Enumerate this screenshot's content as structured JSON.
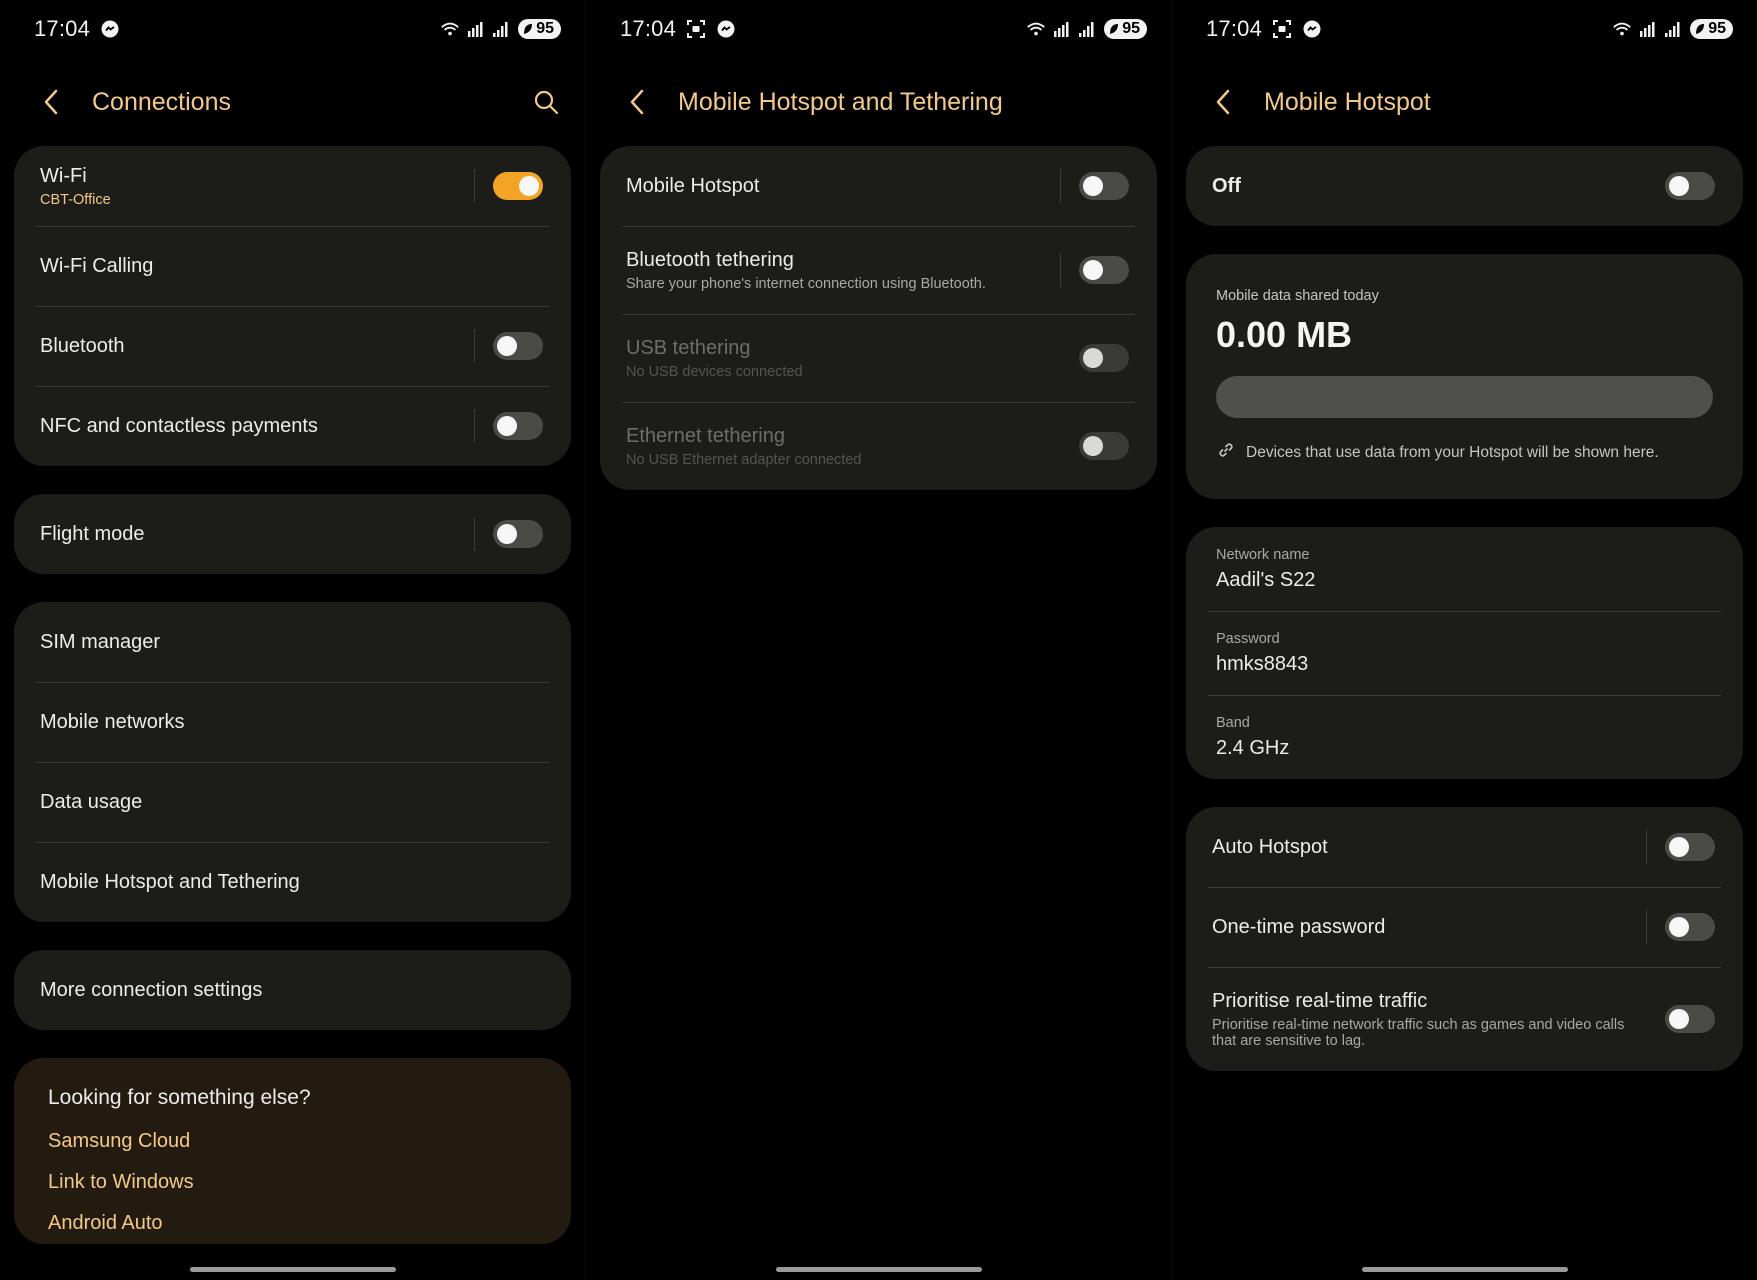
{
  "status": {
    "time": "17:04",
    "battery": "95"
  },
  "colors": {
    "accent": "#f4a424",
    "title": "#f3c98a",
    "card": "#1c1c19"
  },
  "screen1": {
    "title": "Connections",
    "wifi": {
      "label": "Wi-Fi",
      "network": "CBT-Office",
      "on": true
    },
    "wifi_calling": "Wi-Fi Calling",
    "bluetooth": {
      "label": "Bluetooth",
      "on": false
    },
    "nfc": {
      "label": "NFC and contactless payments",
      "on": false
    },
    "flight_mode": {
      "label": "Flight mode",
      "on": false
    },
    "sim_manager": "SIM manager",
    "mobile_networks": "Mobile networks",
    "data_usage": "Data usage",
    "hotspot_tethering": "Mobile Hotspot and Tethering",
    "more_settings": "More connection settings",
    "looking": {
      "question": "Looking for something else?",
      "links": [
        "Samsung Cloud",
        "Link to Windows",
        "Android Auto"
      ]
    }
  },
  "screen2": {
    "title": "Mobile Hotspot and Tethering",
    "mobile_hotspot": {
      "label": "Mobile Hotspot",
      "on": false
    },
    "bluetooth_tethering": {
      "label": "Bluetooth tethering",
      "sub": "Share your phone's internet connection using Bluetooth.",
      "on": false
    },
    "usb_tethering": {
      "label": "USB tethering",
      "sub": "No USB devices connected",
      "on": false
    },
    "ethernet_tethering": {
      "label": "Ethernet tethering",
      "sub": "No USB Ethernet adapter connected",
      "on": false
    }
  },
  "screen3": {
    "title": "Mobile Hotspot",
    "master": {
      "label": "Off",
      "on": false
    },
    "usage": {
      "caption": "Mobile data shared today",
      "amount": "0.00 MB",
      "fill_fraction": 0,
      "hint": "Devices that use data from your Hotspot will be shown here."
    },
    "network_name": {
      "caption": "Network name",
      "value": "Aadil's S22"
    },
    "password": {
      "caption": "Password",
      "value": "hmks8843"
    },
    "band": {
      "caption": "Band",
      "value": "2.4 GHz"
    },
    "auto_hotspot": {
      "label": "Auto Hotspot",
      "on": false
    },
    "one_time_password": {
      "label": "One-time password",
      "on": false
    },
    "prioritise": {
      "label": "Prioritise real-time traffic",
      "sub": "Prioritise real-time network traffic such as games and video calls that are sensitive to lag.",
      "on": false
    }
  }
}
